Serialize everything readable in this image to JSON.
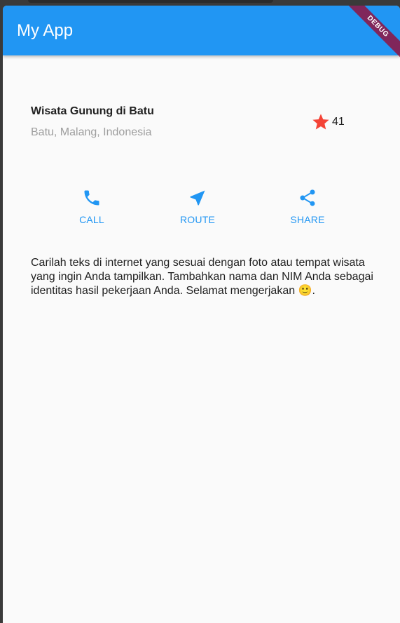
{
  "app": {
    "title": "My App",
    "debug_label": "DEBUG",
    "primary_color": "#2196f3"
  },
  "title_section": {
    "title": "Wisata Gunung di Batu",
    "subtitle": "Batu, Malang, Indonesia",
    "rating_icon": "star-icon",
    "rating_color": "#f44336",
    "rating_count": "41"
  },
  "buttons": [
    {
      "icon": "phone-icon",
      "label": "CALL"
    },
    {
      "icon": "navigation-icon",
      "label": "ROUTE"
    },
    {
      "icon": "share-icon",
      "label": "SHARE"
    }
  ],
  "text_section": {
    "body": "Carilah teks di internet yang sesuai dengan foto atau tempat wisata yang ingin Anda tampilkan. Tambahkan nama dan NIM Anda sebagai identitas hasil pekerjaan Anda. Selamat mengerjakan 🙂."
  }
}
